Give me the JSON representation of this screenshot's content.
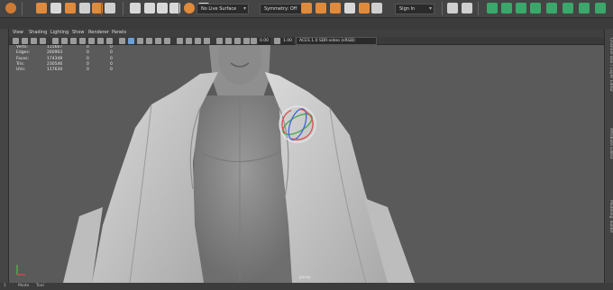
{
  "toolbar": {
    "live_surface": "No Live Surface",
    "symmetry": "Symmetry: Off",
    "sign_in": "Sign In"
  },
  "menu": [
    "View",
    "Shading",
    "Lighting",
    "Show",
    "Renderer",
    "Panels"
  ],
  "panel_toolbar": {
    "value_a": "0.00",
    "value_b": "1.00",
    "color_space": "ACES 1.0 SDR-video (sRGB)"
  },
  "hud": {
    "rows": [
      {
        "label": "Verts:",
        "v1": "115607",
        "v2": "0",
        "v3": "0"
      },
      {
        "label": "Edges:",
        "v1": "260903",
        "v2": "0",
        "v3": "0"
      },
      {
        "label": "Faces:",
        "v1": "174349",
        "v2": "0",
        "v3": "0"
      },
      {
        "label": "Tris:",
        "v1": "230546",
        "v2": "0",
        "v3": "0"
      },
      {
        "label": "UVs:",
        "v1": "117630",
        "v2": "0",
        "v3": "0"
      }
    ]
  },
  "camera_label": "persp",
  "right_panel_tabs": [
    "Channel Box / Layer Editor",
    "Attribute Editor",
    "Modeling Toolkit"
  ],
  "status_bar": {
    "items": [
      "1",
      "Mode",
      "Tool"
    ]
  },
  "colors": {
    "accent": "#e08a3c",
    "viewport": "#5a5a5a",
    "ui": "#444444"
  }
}
